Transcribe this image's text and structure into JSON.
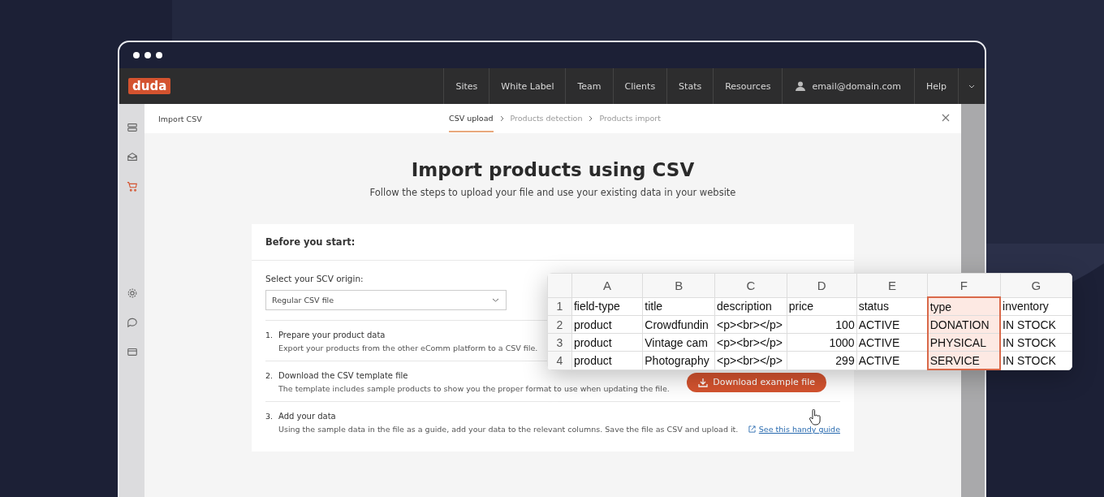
{
  "nav": {
    "logo": "duda",
    "items": [
      "Sites",
      "White Label",
      "Team",
      "Clients",
      "Stats",
      "Resources"
    ],
    "account": "email@domain.com",
    "help": "Help"
  },
  "sidebar": {
    "items": [
      {
        "kind": "layers",
        "selected": false
      },
      {
        "kind": "inbox",
        "selected": false
      },
      {
        "kind": "cart",
        "selected": true
      },
      {
        "kind": "gear",
        "selected": false
      },
      {
        "kind": "chat",
        "selected": false
      },
      {
        "kind": "card",
        "selected": false
      }
    ]
  },
  "modal": {
    "title": "Import CSV",
    "steps": [
      {
        "label": "CSV upload",
        "selected": true
      },
      {
        "label": "Products detection",
        "selected": false
      },
      {
        "label": "Products import",
        "selected": false
      }
    ],
    "heading": "Import products using CSV",
    "subtitle": "Follow the steps to upload your file and use your existing data in your website",
    "card": {
      "title": "Before you start:",
      "select_label": "Select your SCV origin:",
      "select_value": "Regular CSV file",
      "items": [
        {
          "number": "1.",
          "title": "Prepare your product data",
          "description": "Export your products from the other eComm platform to a CSV file."
        },
        {
          "number": "2.",
          "title": "Download the CSV template file",
          "description": "The template includes sample products to show you the proper format to use when updating the file.",
          "action": {
            "kind": "button",
            "label": "Download example file"
          }
        },
        {
          "number": "3.",
          "title": "Add your data",
          "description": "Using the sample data in the file as a guide, add your data to the relevant columns. Save the file as CSV and upload it.",
          "action": {
            "kind": "link",
            "label": "See this handy guide"
          }
        }
      ]
    }
  },
  "spreadsheet": {
    "columns": [
      {
        "letter": "A",
        "kind": "text",
        "highlighted": false
      },
      {
        "letter": "B",
        "kind": "text",
        "highlighted": false
      },
      {
        "letter": "C",
        "kind": "text",
        "highlighted": false
      },
      {
        "letter": "D",
        "kind": "number",
        "highlighted": false
      },
      {
        "letter": "E",
        "kind": "text",
        "highlighted": false
      },
      {
        "letter": "F",
        "kind": "text",
        "highlighted": true
      },
      {
        "letter": "G",
        "kind": "text",
        "highlighted": false
      }
    ],
    "rows": [
      {
        "number": "1",
        "cells": [
          "field-type",
          "title",
          "description",
          "price",
          "status",
          "type",
          "inventory"
        ]
      },
      {
        "number": "2",
        "cells": [
          "product",
          "Crowdfundin",
          "<p><br></p>",
          "100",
          "ACTIVE",
          "DONATION",
          "IN STOCK"
        ]
      },
      {
        "number": "3",
        "cells": [
          "product",
          "Vintage cam",
          "<p><br></p>",
          "1000",
          "ACTIVE",
          "PHYSICAL",
          "IN STOCK"
        ]
      },
      {
        "number": "4",
        "cells": [
          "product",
          "Photography",
          "<p><br></p>",
          "299",
          "ACTIVE",
          "SERVICE",
          "IN STOCK"
        ]
      }
    ]
  }
}
